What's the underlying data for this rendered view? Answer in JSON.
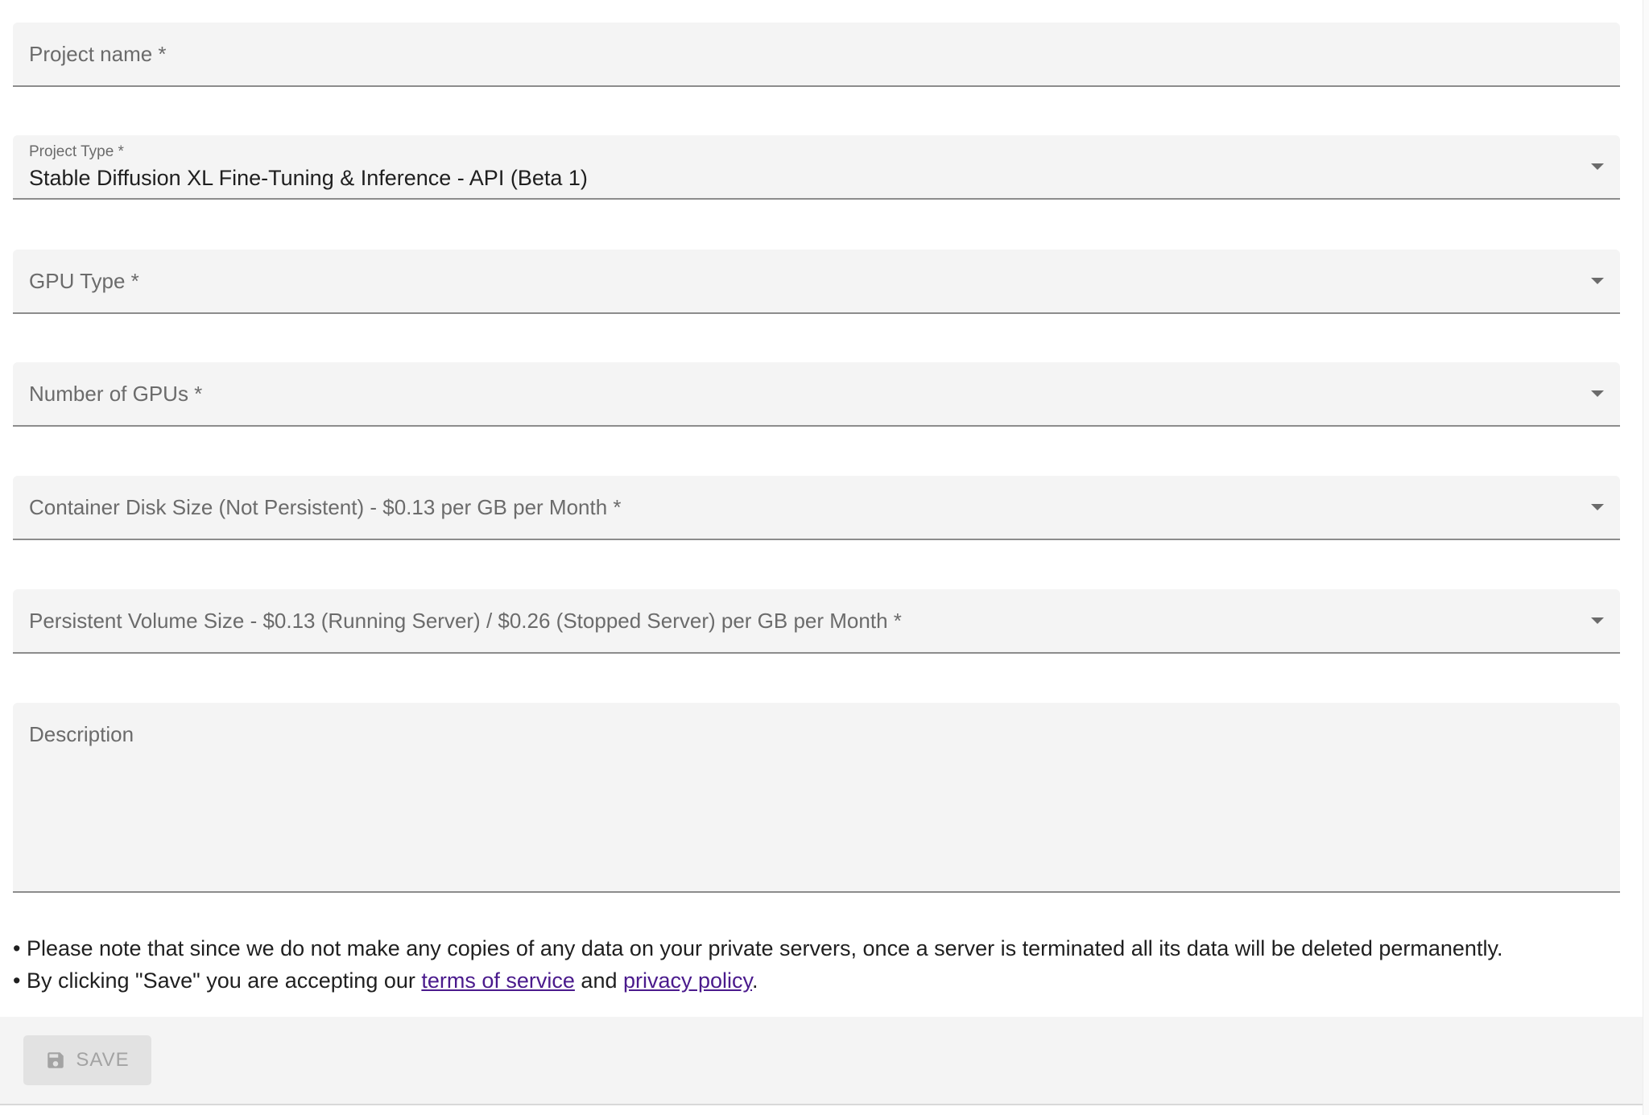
{
  "form": {
    "project_name": {
      "placeholder": "Project name *"
    },
    "project_type": {
      "label": "Project Type *",
      "value": "Stable Diffusion XL Fine-Tuning & Inference - API (Beta 1)"
    },
    "gpu_type": {
      "placeholder": "GPU Type *"
    },
    "num_gpus": {
      "placeholder": "Number of GPUs *"
    },
    "container_disk": {
      "placeholder": "Container Disk Size (Not Persistent) - $0.13 per GB per Month *"
    },
    "persistent_volume": {
      "placeholder": "Persistent Volume Size - $0.13 (Running Server) / $0.26 (Stopped Server) per GB per Month *"
    },
    "description": {
      "placeholder": "Description"
    }
  },
  "notes": {
    "line1": "• Please note that since we do not make any copies of any data on your private servers, once a server is terminated all its data will be deleted permanently.",
    "line2_prefix": "• By clicking \"Save\" you are accepting our ",
    "terms_link": "terms of service",
    "and_text": " and ",
    "privacy_link": "privacy policy",
    "period": "."
  },
  "footer": {
    "save_label": "SAVE",
    "save_icon": "floppy-disk-icon"
  },
  "colors": {
    "field_bg": "#f4f4f4",
    "link": "#4a1a8c",
    "disabled_text": "#a3a3a3"
  }
}
